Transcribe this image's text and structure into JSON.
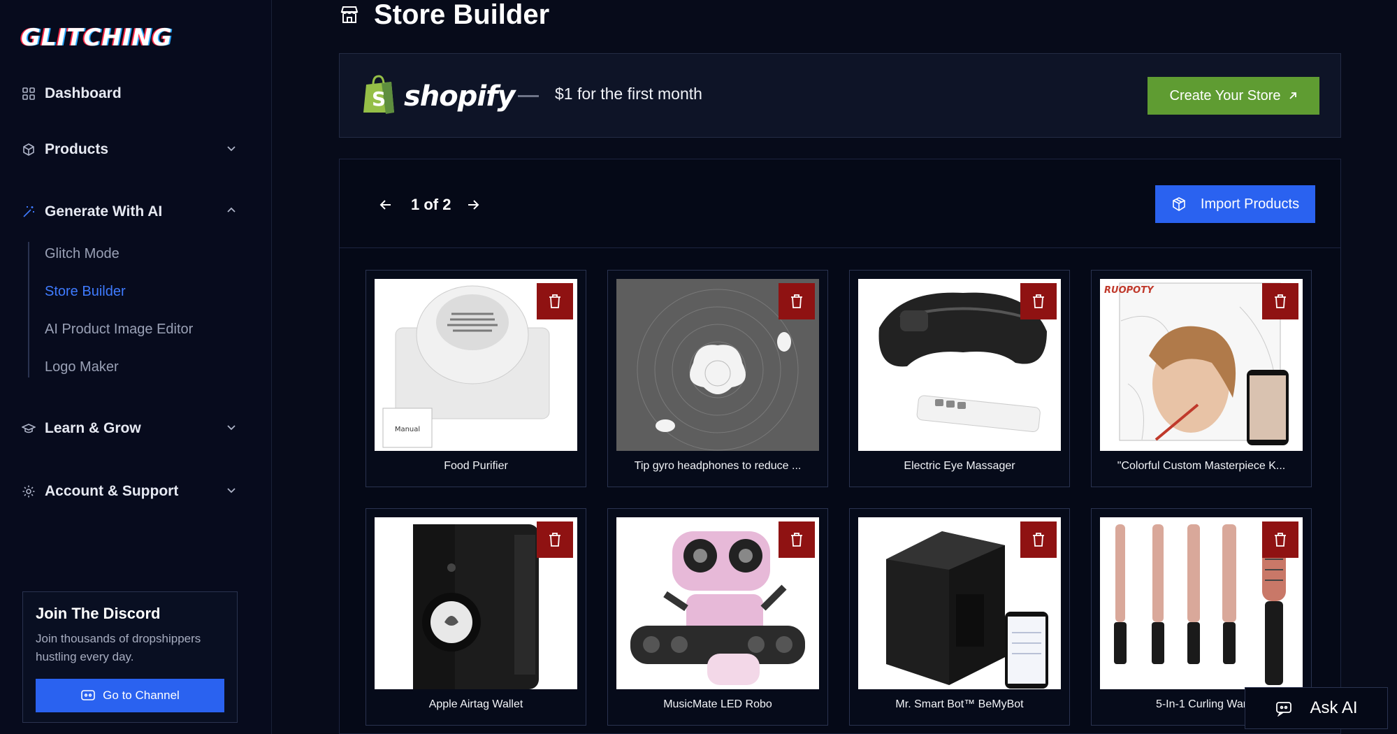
{
  "brand": {
    "logo_text": "GLITCHING"
  },
  "sidebar": {
    "items": [
      {
        "label": "Dashboard",
        "icon": "grid-icon"
      },
      {
        "label": "Products",
        "icon": "box-icon"
      },
      {
        "label": "Generate With AI",
        "icon": "magic-wand-icon"
      },
      {
        "label": "Learn & Grow",
        "icon": "graduation-cap-icon"
      },
      {
        "label": "Account & Support",
        "icon": "gear-icon"
      }
    ],
    "sub_items": [
      {
        "label": "Glitch Mode"
      },
      {
        "label": "Store Builder",
        "active": true
      },
      {
        "label": "AI Product Image Editor"
      },
      {
        "label": "Logo Maker"
      }
    ],
    "discord": {
      "title": "Join The Discord",
      "text": "Join thousands of dropshippers hustling every day.",
      "button": "Go to Channel"
    }
  },
  "page": {
    "title": "Store Builder"
  },
  "shopify": {
    "logo_text": "shopify",
    "offer": "$1 for the first month",
    "button": "Create Your Store",
    "brand_color": "#5f9c32"
  },
  "pager": {
    "text": "1 of 2"
  },
  "import_button": "Import Products",
  "products": [
    {
      "name": "Food Purifier"
    },
    {
      "name": "Tip gyro headphones to reduce ..."
    },
    {
      "name": "Electric Eye Massager"
    },
    {
      "name": "\"Colorful Custom Masterpiece K..."
    },
    {
      "name": "Apple Airtag Wallet"
    },
    {
      "name": "MusicMate LED Robo"
    },
    {
      "name": "Mr. Smart Bot™ BeMyBot"
    },
    {
      "name": "5-In-1 Curling War"
    }
  ],
  "image_text": {
    "manual_label": "Manual",
    "brand_label": "RUOPOTY"
  },
  "ask_ai": "Ask AI",
  "colors": {
    "accent": "#2a62f0",
    "active_nav": "#3f7bff",
    "delete": "#8f1212",
    "background": "#070b1a"
  }
}
